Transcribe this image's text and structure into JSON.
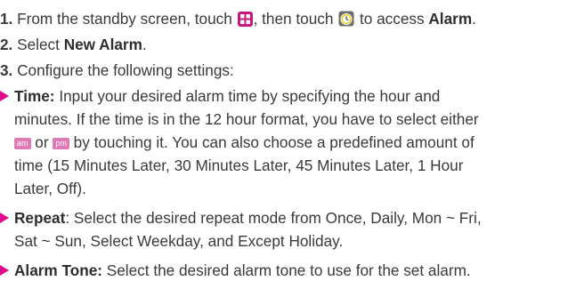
{
  "steps": {
    "step1": {
      "number": "1.",
      "text_a": "From the standby screen, touch",
      "text_b": ", then touch",
      "text_c": "to access",
      "alarm": "Alarm",
      "period": ".",
      "icons": [
        "grid-icon",
        "alarm-clock-icon"
      ]
    },
    "step2": {
      "number": "2.",
      "text": "Select",
      "new_alarm": "New Alarm",
      "period": "."
    },
    "step3": {
      "number": "3.",
      "text": "Configure the following settings:"
    }
  },
  "bullets": {
    "time": {
      "label": "Time:",
      "l1": "Input your desired alarm time by specifying the hour and",
      "l2": "minutes. If the time is in the 12 hour format, you have to select either",
      "am": "am",
      "or": "or",
      "pm": "pm",
      "l3_rest": "by touching it. You can also choose a predefined amount of",
      "l4": "time (15 Minutes Later, 30 Minutes Later, 45 Minutes Later, 1 Hour",
      "l5": "Later, Off)."
    },
    "repeat": {
      "label": "Repeat",
      "l1": ": Select the desired repeat mode from Once, Daily, Mon ~ Fri,",
      "l2": "Sat ~ Sun, Select Weekday, and Except Holiday."
    },
    "tone": {
      "label": "Alarm Tone:",
      "l1": "Select the desired alarm tone to use for the set alarm."
    }
  },
  "colors": {
    "bullet": "#e10a8c",
    "icon": "#c6177f",
    "chip": "#e07ab6"
  }
}
